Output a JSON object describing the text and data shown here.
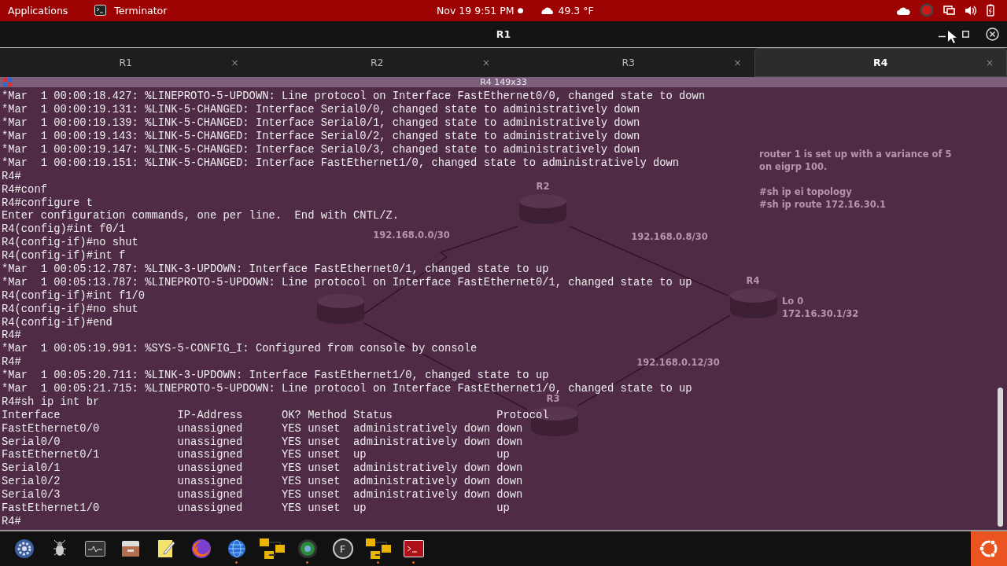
{
  "top_bar": {
    "menu": "Applications",
    "app": "Terminator",
    "clock": "Nov 19  9:51 PM",
    "clock_dot": "●",
    "weather": "49.3 °F"
  },
  "window": {
    "title": "R1"
  },
  "tabs": [
    {
      "label": "R1",
      "close": "×",
      "selected": false
    },
    {
      "label": "R2",
      "close": "×",
      "selected": false
    },
    {
      "label": "R3",
      "close": "×",
      "selected": false
    },
    {
      "label": "R4",
      "close": "×",
      "selected": true
    }
  ],
  "terminal": {
    "title": "R4 149x33",
    "lines": [
      "*Mar  1 00:00:18.427: %LINEPROTO-5-UPDOWN: Line protocol on Interface FastEthernet0/0, changed state to down",
      "*Mar  1 00:00:19.131: %LINK-5-CHANGED: Interface Serial0/0, changed state to administratively down",
      "*Mar  1 00:00:19.139: %LINK-5-CHANGED: Interface Serial0/1, changed state to administratively down",
      "*Mar  1 00:00:19.143: %LINK-5-CHANGED: Interface Serial0/2, changed state to administratively down",
      "*Mar  1 00:00:19.147: %LINK-5-CHANGED: Interface Serial0/3, changed state to administratively down",
      "*Mar  1 00:00:19.151: %LINK-5-CHANGED: Interface FastEthernet1/0, changed state to administratively down",
      "R4#",
      "R4#conf",
      "R4#configure t",
      "Enter configuration commands, one per line.  End with CNTL/Z.",
      "R4(config)#int f0/1",
      "R4(config-if)#no shut",
      "R4(config-if)#int f",
      "*Mar  1 00:05:12.787: %LINK-3-UPDOWN: Interface FastEthernet0/1, changed state to up",
      "*Mar  1 00:05:13.787: %LINEPROTO-5-UPDOWN: Line protocol on Interface FastEthernet0/1, changed state to up",
      "R4(config-if)#int f1/0",
      "R4(config-if)#no shut",
      "R4(config-if)#end",
      "R4#",
      "*Mar  1 00:05:19.991: %SYS-5-CONFIG_I: Configured from console by console",
      "R4#",
      "*Mar  1 00:05:20.711: %LINK-3-UPDOWN: Interface FastEthernet1/0, changed state to up",
      "*Mar  1 00:05:21.715: %LINEPROTO-5-UPDOWN: Line protocol on Interface FastEthernet1/0, changed state to up",
      "R4#sh ip int br",
      "Interface                  IP-Address      OK? Method Status                Protocol",
      "FastEthernet0/0            unassigned      YES unset  administratively down down",
      "Serial0/0                  unassigned      YES unset  administratively down down",
      "FastEthernet0/1            unassigned      YES unset  up                    up",
      "Serial0/1                  unassigned      YES unset  administratively down down",
      "Serial0/2                  unassigned      YES unset  administratively down down",
      "Serial0/3                  unassigned      YES unset  administratively down down",
      "FastEthernet1/0            unassigned      YES unset  up                    up",
      "R4#"
    ]
  },
  "topology": {
    "routers": [
      "R2",
      "R4",
      "R3"
    ],
    "links": [
      "192.168.0.0/30",
      "192.168.0.8/30",
      "192.168.0.12/30"
    ],
    "loopback": [
      "Lo 0",
      "172.16.30.1/32"
    ],
    "notes": [
      "router 1 is set up with a variance of 5",
      "on eigrp 100.",
      "#sh ip ei topology",
      "#sh ip route 172.16.30.1"
    ]
  },
  "dock": [
    {
      "kind": "settings",
      "running": false
    },
    {
      "kind": "bug",
      "running": false
    },
    {
      "kind": "monitor",
      "running": false
    },
    {
      "kind": "files",
      "running": false
    },
    {
      "kind": "notes",
      "running": false
    },
    {
      "kind": "firefox",
      "running": false
    },
    {
      "kind": "browser",
      "running": true
    },
    {
      "kind": "network",
      "running": false
    },
    {
      "kind": "globe",
      "running": true
    },
    {
      "kind": "letter",
      "running": false,
      "letter": "F"
    },
    {
      "kind": "network",
      "running": true
    },
    {
      "kind": "terminal",
      "running": true
    }
  ]
}
